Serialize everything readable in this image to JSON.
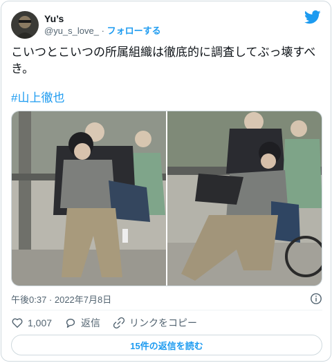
{
  "user": {
    "display_name": "Yu’s",
    "handle": "@yu_s_love_",
    "separator": "·",
    "follow_label": "フォローする"
  },
  "tweet": {
    "text": "こいつとこいつの所属組織は徹底的に調査してぶっ壊すべき。",
    "hashtag": "#山上徹也",
    "timestamp": "午後0:37 · 2022年7月8日"
  },
  "actions": {
    "like_count": "1,007",
    "reply_label": "返信",
    "copy_link_label": "リンクをコピー"
  },
  "replies_button": "15件の返信を読む",
  "colors": {
    "accent": "#1d9bf0",
    "text": "#0f1419",
    "muted": "#536471",
    "border": "#cfd9de"
  },
  "icons": [
    "twitter-bird-icon",
    "info-icon",
    "heart-icon",
    "reply-icon",
    "link-icon"
  ]
}
